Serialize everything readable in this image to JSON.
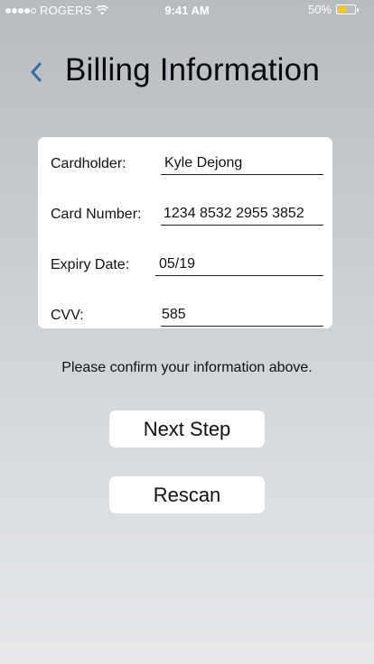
{
  "status_bar": {
    "carrier": "ROGERS",
    "time": "9:41 AM",
    "battery_percent_label": "50%",
    "battery_level": 0.5,
    "signal_bars_filled": 4,
    "signal_bars_total": 5,
    "battery_color": "#f5c518"
  },
  "header": {
    "title": "Billing Information",
    "back_icon": "chevron-left-icon",
    "accent_color": "#2f6fa3"
  },
  "form": {
    "fields": [
      {
        "label": "Cardholder:",
        "value": "Kyle Dejong"
      },
      {
        "label": "Card Number:",
        "value": "1234 8532 2955 3852"
      },
      {
        "label": "Expiry Date:",
        "value": "05/19"
      },
      {
        "label": "CVV:",
        "value": "585"
      }
    ]
  },
  "confirm_text": "Please confirm your information above.",
  "buttons": {
    "next_step": "Next Step",
    "rescan": "Rescan"
  }
}
